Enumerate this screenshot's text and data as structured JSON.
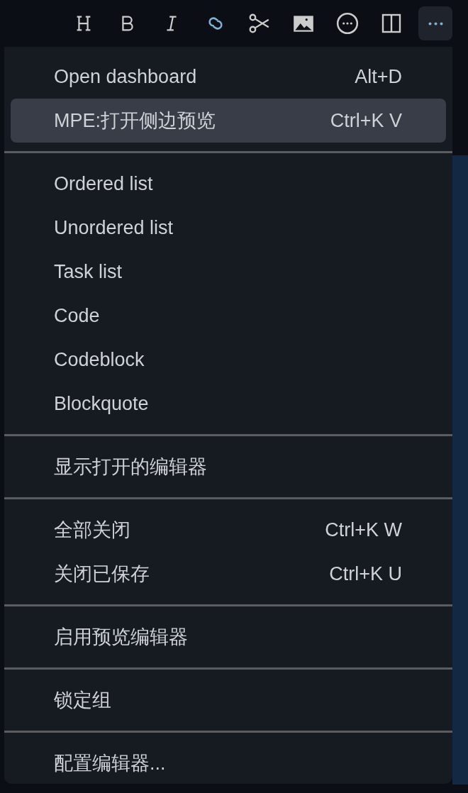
{
  "toolbar": {
    "buttons": [
      {
        "kind": "heading"
      },
      {
        "kind": "bold"
      },
      {
        "kind": "italic"
      },
      {
        "kind": "link"
      },
      {
        "kind": "scissors"
      },
      {
        "kind": "image"
      },
      {
        "kind": "emoji"
      },
      {
        "kind": "split"
      },
      {
        "kind": "more",
        "selected": true
      }
    ]
  },
  "menu": {
    "groups": [
      [
        {
          "label": "Open dashboard",
          "shortcut": "Alt+D",
          "selected": false
        },
        {
          "label": "MPE:打开侧边预览",
          "shortcut": "Ctrl+K V",
          "selected": true
        }
      ],
      [
        {
          "label": "Ordered list",
          "selected": false
        },
        {
          "label": "Unordered list",
          "selected": false
        },
        {
          "label": "Task list",
          "selected": false
        },
        {
          "label": "Code",
          "selected": false
        },
        {
          "label": "Codeblock",
          "selected": false
        },
        {
          "label": "Blockquote",
          "selected": false
        }
      ],
      [
        {
          "label": "显示打开的编辑器",
          "selected": false
        }
      ],
      [
        {
          "label": "全部关闭",
          "shortcut": "Ctrl+K W",
          "selected": false
        },
        {
          "label": "关闭已保存",
          "shortcut": "Ctrl+K U",
          "selected": false
        }
      ],
      [
        {
          "label": "启用预览编辑器",
          "selected": false
        }
      ],
      [
        {
          "label": "锁定组",
          "selected": false
        }
      ],
      [
        {
          "label": "配置编辑器...",
          "selected": false
        }
      ]
    ]
  }
}
